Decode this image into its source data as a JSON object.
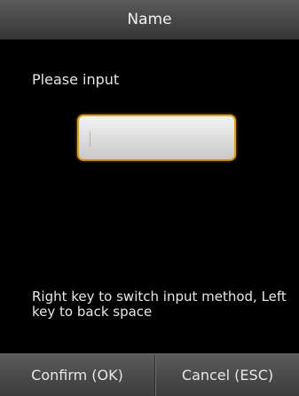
{
  "title": "Name",
  "prompt": "Please input",
  "input": {
    "value": ""
  },
  "hint": "Right key to switch input method, Left key to back space",
  "footer": {
    "confirm_label": "Confirm (OK)",
    "cancel_label": "Cancel (ESC)"
  },
  "colors": {
    "screen_background": "#000000",
    "bar_background": "#4a4a4a",
    "input_border": "#d9a227",
    "text": "#e6e6e6"
  }
}
